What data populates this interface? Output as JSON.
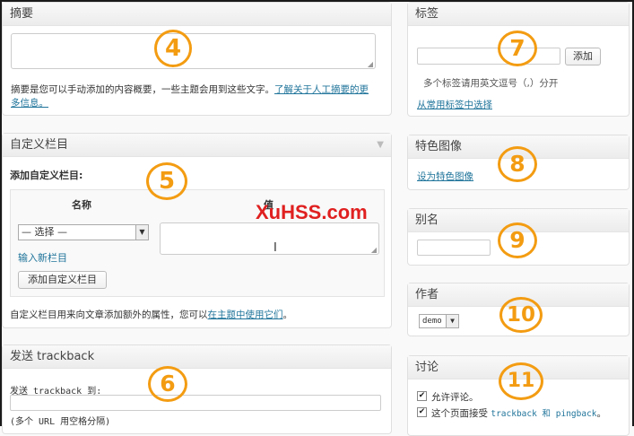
{
  "excerpt": {
    "title": "摘要",
    "help_text": "摘要是您可以手动添加的内容概要，一些主题会用到这些文字。",
    "help_link_line1": "了解关于人工摘要的更",
    "help_link_line2": "多信息。",
    "badge": "4"
  },
  "custom_fields": {
    "title": "自定义栏目",
    "add_heading": "添加自定义栏目:",
    "col_name": "名称",
    "col_value": "值",
    "select_value": "— 选择 —",
    "enter_new_link": "输入新栏目",
    "add_button": "添加自定义栏目",
    "footer_text": "自定义栏目用来向文章添加额外的属性，您可以",
    "footer_link": "在主题中使用它们",
    "footer_end": "。",
    "badge": "5"
  },
  "trackback": {
    "title": "发送 trackback",
    "label": "发送 trackback 到:",
    "hint": "(多个 URL 用空格分隔)",
    "badge": "6"
  },
  "tags": {
    "title": "标签",
    "add_button": "添加",
    "hint": "多个标签请用英文逗号（,）分开",
    "choose_link": "从常用标签中选择",
    "badge": "7"
  },
  "featured_image": {
    "title": "特色图像",
    "set_link": "设为特色图像",
    "badge": "8"
  },
  "slug": {
    "title": "别名",
    "badge": "9"
  },
  "author": {
    "title": "作者",
    "select_value": "demo",
    "badge": "10"
  },
  "discussion": {
    "title": "讨论",
    "allow_comments": "允许评论。",
    "allow_trackbacks_prefix": "这个页面接受 ",
    "allow_trackbacks_link": "trackback 和 pingback",
    "allow_trackbacks_suffix": "。",
    "badge": "11"
  },
  "watermark": "XuHSS.com",
  "colors": {
    "badge": "#f39c12",
    "link": "#21759b",
    "watermark": "#e02020"
  }
}
